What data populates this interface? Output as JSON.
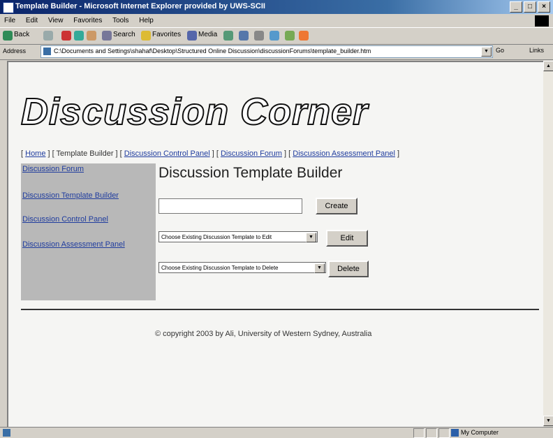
{
  "window": {
    "title": "Template Builder - Microsoft Internet Explorer provided by UWS-SCII"
  },
  "menu": [
    "File",
    "Edit",
    "View",
    "Favorites",
    "Tools",
    "Help"
  ],
  "toolbar": {
    "back": "Back",
    "search": "Search",
    "favorites": "Favorites",
    "media": "Media"
  },
  "address": {
    "label": "Address",
    "url": "C:\\Documents and Settings\\shahaf\\Desktop\\Structured Online Discussion\\discussionForums\\template_builder.htm",
    "go": "Go",
    "links": "Links"
  },
  "page": {
    "logo": "Discussion Corner",
    "nav": {
      "open1": "[ ",
      "home": "Home",
      "sep1": " ] [ Template Builder ] [ ",
      "control_panel": "Discussion Control Panel",
      "sep2": " ] [ ",
      "forum": "Discussion Forum",
      "sep3": " ] [ ",
      "assessment": "Discussion Assessment Panel",
      "close": " ]"
    },
    "sidebar": [
      "Discussion Forum",
      "Discussion Template Builder",
      "Discussion Control Panel",
      "Discussion Assessment Panel"
    ],
    "heading": "Discussion Template Builder",
    "create_input_value": "",
    "create_button": "Create",
    "edit_select": "Choose Existing Discussion Template to Edit",
    "edit_button": "Edit",
    "delete_select": "Choose Existing Discussion Template to Delete",
    "delete_button": "Delete",
    "copyright": "© copyright 2003 by Ali, University of Western Sydney, Australia"
  },
  "status": {
    "zone": "My Computer"
  }
}
